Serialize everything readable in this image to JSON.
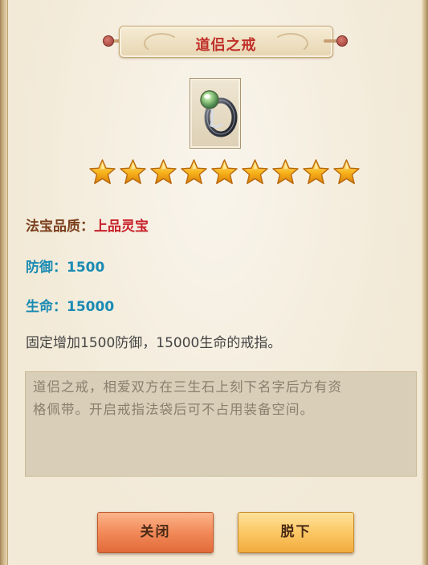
{
  "item": {
    "name": "道侣之戒",
    "icon": "ring-icon",
    "star_rating": 9
  },
  "stats": {
    "quality_label": "法宝品质：",
    "quality_value": "上品灵宝",
    "defense": "防御：1500",
    "life": "生命：15000"
  },
  "effect_text": "固定增加1500防御，15000生命的戒指。",
  "lore": {
    "line1": "道侣之戒，相爱双方在三生石上刻下名字后方有资",
    "line2": "格佩带。开启戒指法袋后可不占用装备空间。"
  },
  "buttons": {
    "close": "关闭",
    "unequip": "脱下"
  },
  "colors": {
    "title": "#c0302a",
    "quality_value": "#c8202a",
    "stat": "#1a8bb3",
    "star": "#f7b21a"
  }
}
